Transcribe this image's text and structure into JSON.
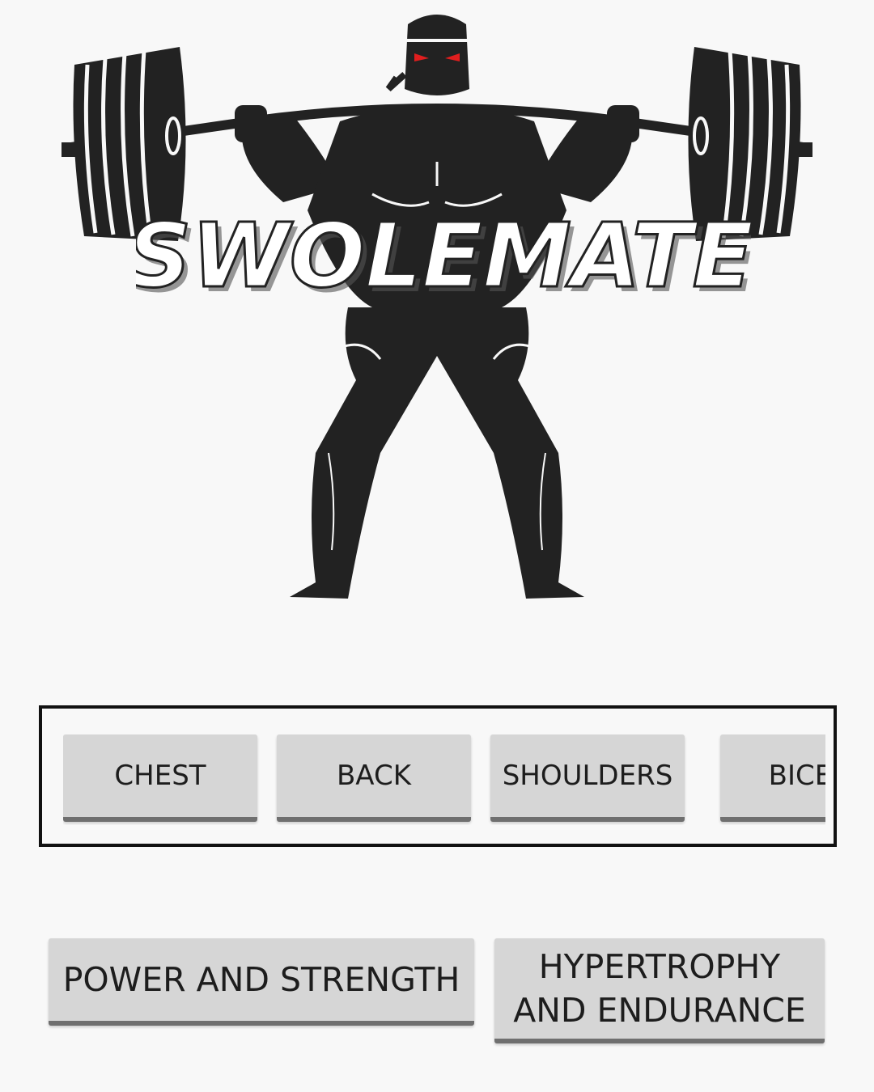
{
  "brand": {
    "logo_text": "SWOLEMATE",
    "eye_color": "#e01e1e",
    "silhouette_color": "#222222"
  },
  "muscle_groups": [
    {
      "label": "CHEST"
    },
    {
      "label": "BACK"
    },
    {
      "label": "SHOULDERS"
    },
    {
      "label": "BICEPS"
    }
  ],
  "programs": [
    {
      "label": "POWER AND STRENGTH"
    },
    {
      "label_line1": "HYPERTROPHY",
      "label_line2": "AND ENDURANCE"
    }
  ],
  "colors": {
    "background": "#f8f8f8",
    "button_bg": "#d6d6d6",
    "button_underline": "#6f6f6f",
    "strip_border": "#111111"
  }
}
